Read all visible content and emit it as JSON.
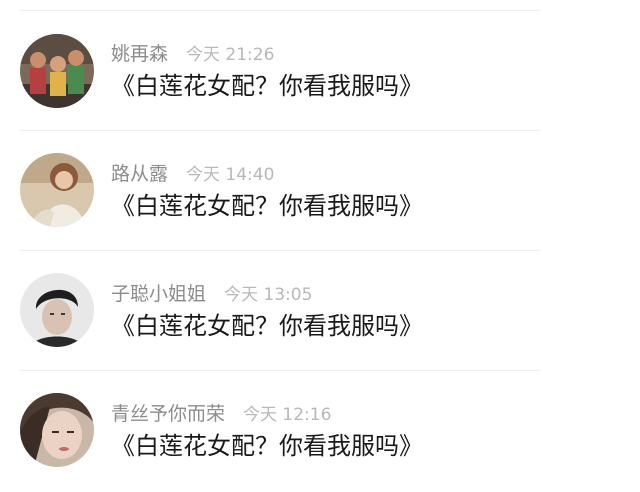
{
  "comments": [
    {
      "name": "姚再森",
      "time": "今天 21:26",
      "text": "《白莲花女配？你看我服吗》",
      "avatar_icon": "group-photo-avatar"
    },
    {
      "name": "路从露",
      "time": "今天 14:40",
      "text": "《白莲花女配？你看我服吗》",
      "avatar_icon": "woman-portrait-avatar"
    },
    {
      "name": "子聪小姐姐",
      "time": "今天 13:05",
      "text": "《白莲花女配？你看我服吗》",
      "avatar_icon": "man-portrait-avatar"
    },
    {
      "name": "青丝予你而荣",
      "time": "今天 12:16",
      "text": "《白莲花女配？你看我服吗》",
      "avatar_icon": "woman-closeup-avatar"
    }
  ]
}
